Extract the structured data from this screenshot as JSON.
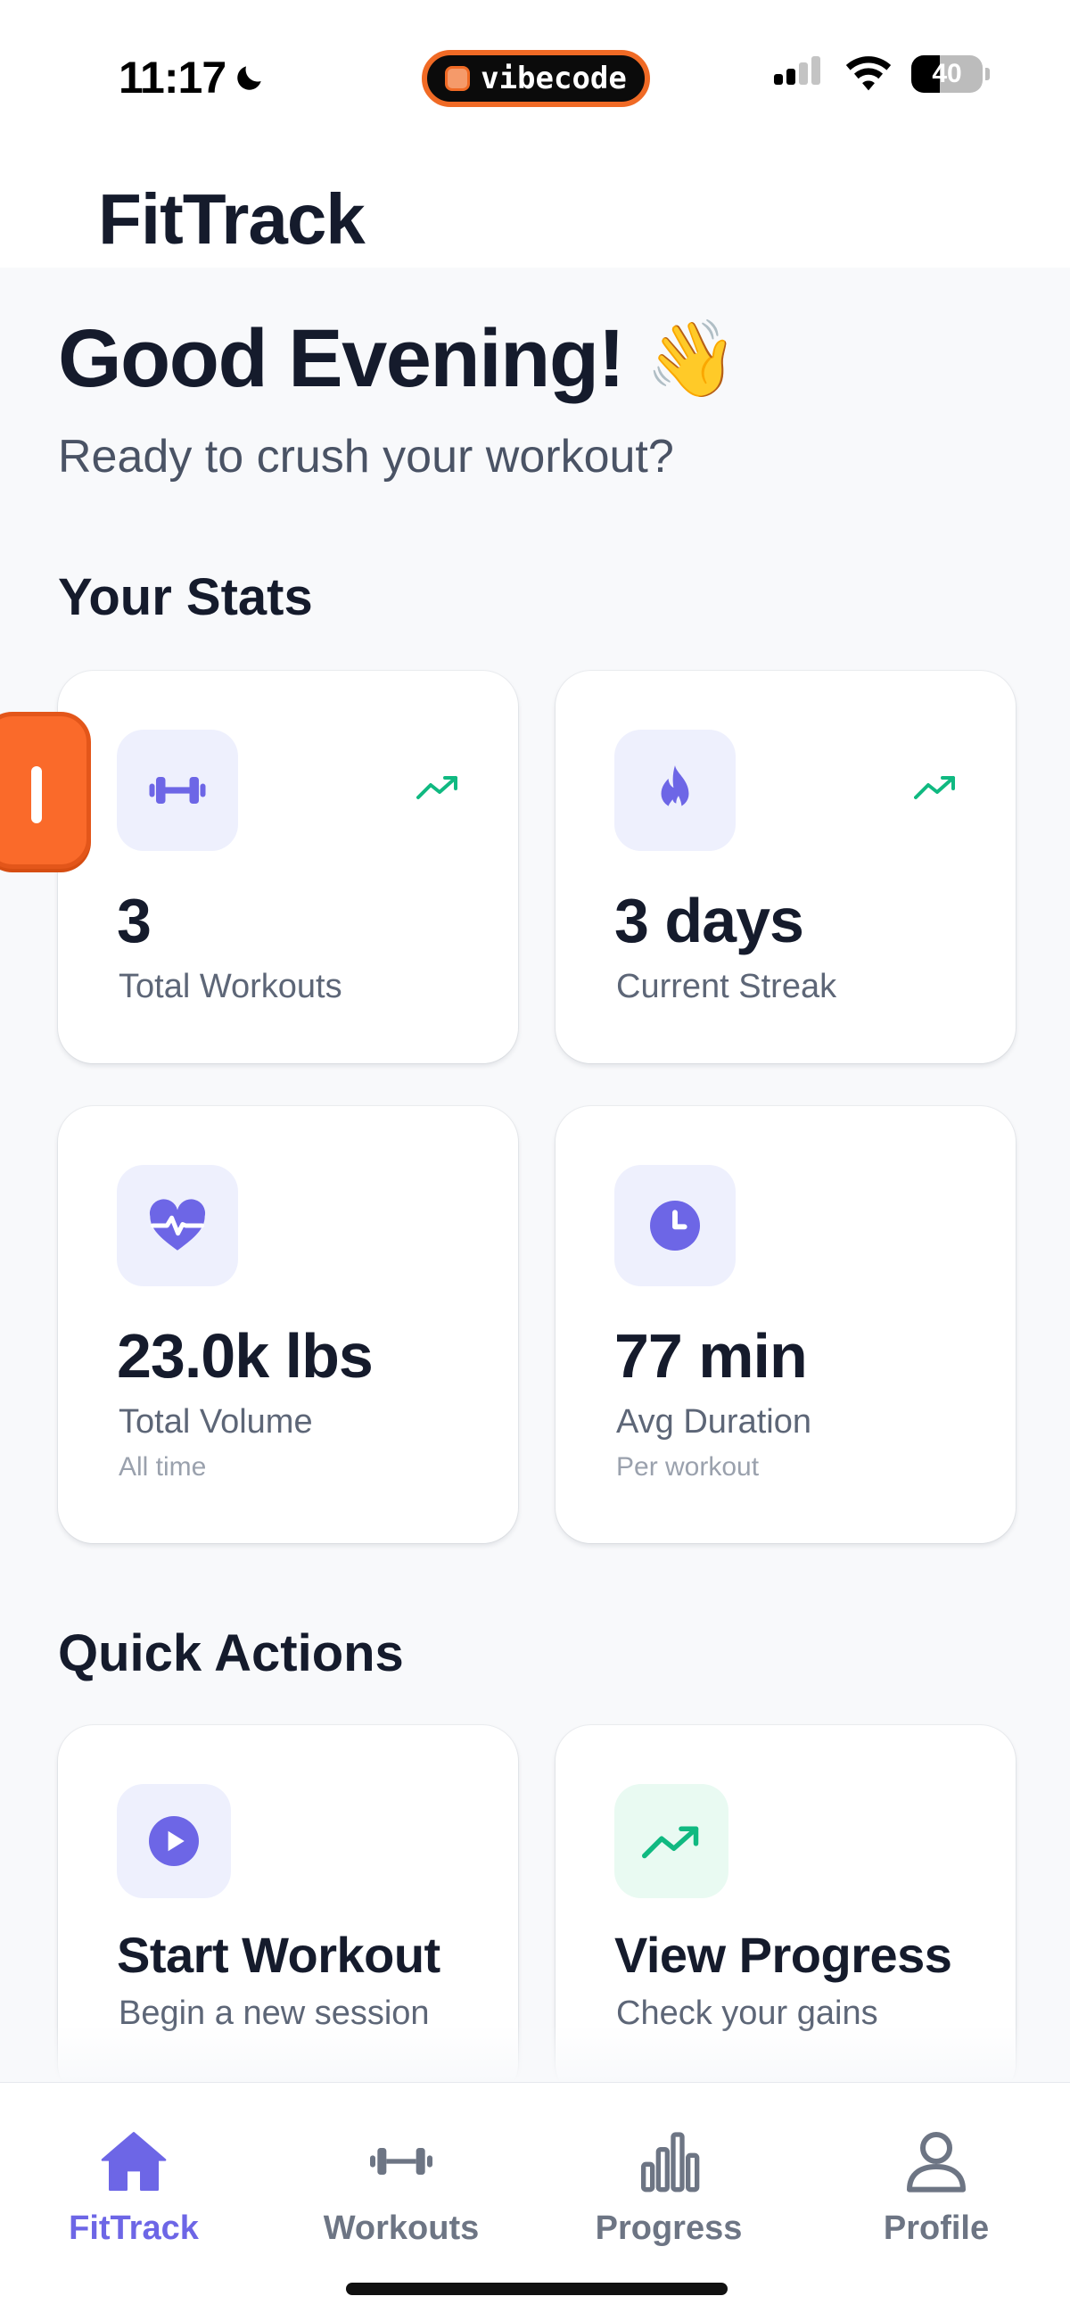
{
  "status_bar": {
    "time": "11:17",
    "app_pill": "vibecode",
    "battery": "40",
    "battery_level": 0.4
  },
  "header": {
    "title": "FitTrack"
  },
  "greeting": {
    "title": "Good Evening!",
    "emoji": "👋",
    "subtitle": "Ready to crush your workout?"
  },
  "stats": {
    "section_title": "Your Stats",
    "cards": [
      {
        "icon": "dumbbell-icon",
        "trend": "trending-up-icon",
        "value": "3",
        "label": "Total Workouts",
        "sublabel": ""
      },
      {
        "icon": "flame-icon",
        "trend": "trending-up-icon",
        "value": "3 days",
        "label": "Current Streak",
        "sublabel": ""
      },
      {
        "icon": "heart-pulse-icon",
        "value": "23.0k lbs",
        "label": "Total Volume",
        "sublabel": "All time"
      },
      {
        "icon": "clock-icon",
        "value": "77 min",
        "label": "Avg Duration",
        "sublabel": "Per workout"
      }
    ]
  },
  "quick_actions": {
    "section_title": "Quick Actions",
    "items": [
      {
        "icon": "play-icon",
        "title": "Start Workout",
        "subtitle": "Begin a new session"
      },
      {
        "icon": "trending-up-icon",
        "title": "View Progress",
        "subtitle": "Check your gains"
      }
    ]
  },
  "tab_bar": {
    "items": [
      {
        "icon": "home-icon",
        "label": "FitTrack",
        "active": true
      },
      {
        "icon": "dumbbell-icon",
        "label": "Workouts",
        "active": false
      },
      {
        "icon": "bar-chart-icon",
        "label": "Progress",
        "active": false
      },
      {
        "icon": "user-icon",
        "label": "Profile",
        "active": false
      }
    ]
  },
  "colors": {
    "accent": "#6d66e6",
    "icon_bg": "#eef0fd",
    "trend_green": "#10b981",
    "green_bg": "#e9faf2",
    "text_primary": "#151b2c",
    "text_secondary": "#5d6677",
    "tab_inactive": "#6d7584",
    "background": "#f8f9fb",
    "pill_orange": "#f06a25"
  }
}
